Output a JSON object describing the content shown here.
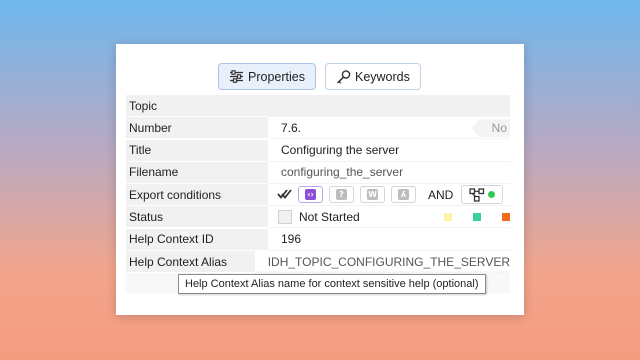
{
  "tabs": [
    {
      "label": "Properties",
      "icon": "sliders-icon",
      "active": true
    },
    {
      "label": "Keywords",
      "icon": "key-icon",
      "active": false
    }
  ],
  "fields": {
    "topic": {
      "label": "Topic"
    },
    "number": {
      "label": "Number",
      "value": "7.6.",
      "button": "No"
    },
    "title": {
      "label": "Title",
      "value": "Configuring the server"
    },
    "filename": {
      "label": "Filename",
      "value": "configuring_the_server"
    },
    "export_conditions": {
      "label": "Export conditions",
      "and_label": "AND",
      "buttons": [
        "check-all-icon",
        "html-icon",
        "help-icon",
        "word-icon",
        "pdf-icon"
      ],
      "colors": {
        "html": "#8a4fd6",
        "help": "#bdbdbd",
        "word": "#bdbdbd",
        "pdf": "#bdbdbd"
      }
    },
    "status": {
      "label": "Status",
      "value": "Not Started",
      "swatches": [
        "#fbf3a6",
        "#37d39a",
        "#f26a1b"
      ]
    },
    "help_context_id": {
      "label": "Help Context ID",
      "value": "196"
    },
    "help_context_alias": {
      "label": "Help Context Alias",
      "value": "IDH_TOPIC_CONFIGURING_THE_SERVER"
    }
  },
  "tooltip": "Help Context Alias name for context sensitive help (optional)"
}
